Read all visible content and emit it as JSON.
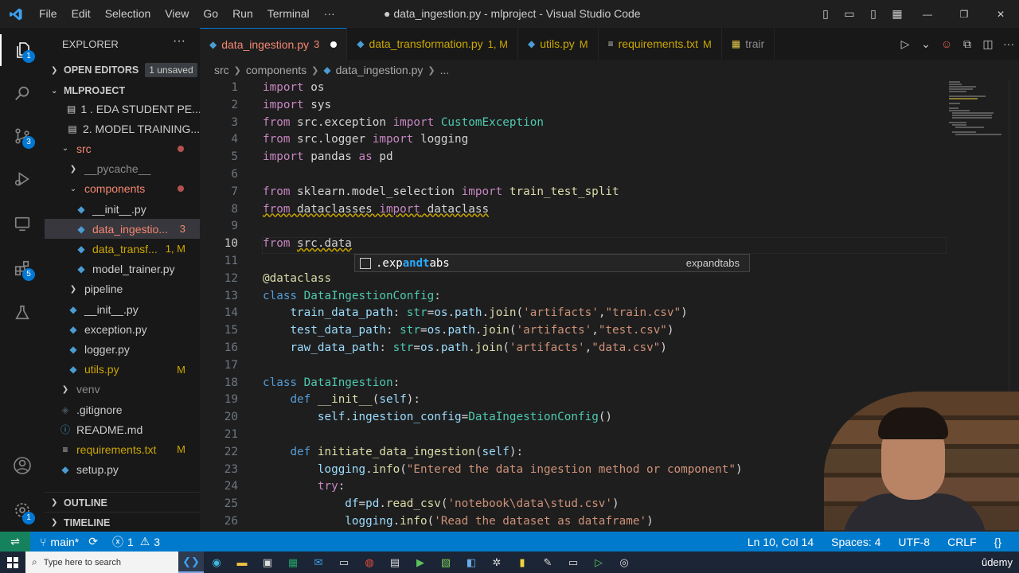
{
  "titlebar": {
    "menu": [
      "File",
      "Edit",
      "Selection",
      "View",
      "Go",
      "Run",
      "Terminal",
      "···"
    ],
    "window_title": "● data_ingestion.py - mlproject - Visual Studio Code"
  },
  "activity": {
    "explorer_badge": "1",
    "source_control_badge": "3",
    "extensions_badge": "5"
  },
  "sidebar": {
    "title": "EXPLORER",
    "open_editors": "OPEN EDITORS",
    "unsaved": "1 unsaved",
    "project": "MLPROJECT",
    "items": [
      {
        "label": "1 . EDA STUDENT PE...",
        "kind": "file",
        "indent": 1,
        "status": ""
      },
      {
        "label": "2. MODEL TRAINING...",
        "kind": "notebook",
        "indent": 1,
        "status": ""
      },
      {
        "label": "src",
        "kind": "folder-open",
        "indent": 0,
        "status": "dot"
      },
      {
        "label": "__pycache__",
        "kind": "folder",
        "indent": 1,
        "status": ""
      },
      {
        "label": "components",
        "kind": "folder-open",
        "indent": 1,
        "status": "dot"
      },
      {
        "label": "__init__.py",
        "kind": "py",
        "indent": 2,
        "status": ""
      },
      {
        "label": "data_ingestio...",
        "kind": "py",
        "indent": 2,
        "status": "3"
      },
      {
        "label": "data_transf...",
        "kind": "py",
        "indent": 2,
        "status": "1, M"
      },
      {
        "label": "model_trainer.py",
        "kind": "py",
        "indent": 2,
        "status": ""
      },
      {
        "label": "pipeline",
        "kind": "folder",
        "indent": 1,
        "status": ""
      },
      {
        "label": "__init__.py",
        "kind": "py",
        "indent": 1,
        "status": ""
      },
      {
        "label": "exception.py",
        "kind": "py",
        "indent": 1,
        "status": ""
      },
      {
        "label": "logger.py",
        "kind": "py",
        "indent": 1,
        "status": ""
      },
      {
        "label": "utils.py",
        "kind": "py",
        "indent": 1,
        "status": "M"
      },
      {
        "label": "venv",
        "kind": "folder",
        "indent": 0,
        "status": ""
      },
      {
        "label": ".gitignore",
        "kind": "git",
        "indent": 0,
        "status": ""
      },
      {
        "label": "README.md",
        "kind": "md",
        "indent": 0,
        "status": ""
      },
      {
        "label": "requirements.txt",
        "kind": "txt",
        "indent": 0,
        "status": "M"
      },
      {
        "label": "setup.py",
        "kind": "py",
        "indent": 0,
        "status": ""
      }
    ],
    "outline": "OUTLINE",
    "timeline": "TIMELINE"
  },
  "tabs": [
    {
      "label": "data_ingestion.py",
      "mod": "3",
      "active": true,
      "dirty": true
    },
    {
      "label": "data_transformation.py",
      "mod": "1, M",
      "active": false,
      "dirty": false
    },
    {
      "label": "utils.py",
      "mod": "M",
      "active": false,
      "dirty": false
    },
    {
      "label": "requirements.txt",
      "mod": "M",
      "active": false,
      "dirty": false
    },
    {
      "label": "trair",
      "mod": "",
      "active": false,
      "dirty": false
    }
  ],
  "breadcrumb": [
    "src",
    "components",
    "data_ingestion.py",
    "..."
  ],
  "editor": {
    "current_line": 10,
    "lines": [
      [
        [
          "kw",
          "import"
        ],
        [
          "t",
          " os"
        ]
      ],
      [
        [
          "kw",
          "import"
        ],
        [
          "t",
          " sys"
        ]
      ],
      [
        [
          "kw",
          "from"
        ],
        [
          "t",
          " src.exception "
        ],
        [
          "kw",
          "import"
        ],
        [
          "t",
          " "
        ],
        [
          "cls",
          "CustomException"
        ]
      ],
      [
        [
          "kw",
          "from"
        ],
        [
          "t",
          " src.logger "
        ],
        [
          "kw",
          "import"
        ],
        [
          "t",
          " logging"
        ]
      ],
      [
        [
          "kw",
          "import"
        ],
        [
          "t",
          " pandas "
        ],
        [
          "kw",
          "as"
        ],
        [
          "t",
          " pd"
        ]
      ],
      [],
      [
        [
          "kw",
          "from"
        ],
        [
          "t",
          " sklearn.model_selection "
        ],
        [
          "kw",
          "import"
        ],
        [
          "t",
          " "
        ],
        [
          "fn",
          "train_test_split"
        ]
      ],
      [
        [
          "kwsq",
          "from"
        ],
        [
          "tsq",
          " dataclasses "
        ],
        [
          "kwsq",
          "import"
        ],
        [
          "tsq",
          " dataclass"
        ]
      ],
      [],
      [
        [
          "kw",
          "from"
        ],
        [
          "t",
          " "
        ],
        [
          "tsq",
          "src.data"
        ]
      ],
      [],
      [
        [
          "fn",
          "@dataclass"
        ]
      ],
      [
        [
          "kb",
          "class"
        ],
        [
          "t",
          " "
        ],
        [
          "cls",
          "DataIngestionConfig"
        ],
        [
          "t",
          ":"
        ]
      ],
      [
        [
          "t",
          "    "
        ],
        [
          "vr",
          "train_data_path"
        ],
        [
          "t",
          ": "
        ],
        [
          "cls",
          "str"
        ],
        [
          "t",
          "="
        ],
        [
          "vr",
          "os"
        ],
        [
          "t",
          "."
        ],
        [
          "vr",
          "path"
        ],
        [
          "t",
          "."
        ],
        [
          "fn",
          "join"
        ],
        [
          "t",
          "("
        ],
        [
          "str",
          "'artifacts'"
        ],
        [
          "t",
          ","
        ],
        [
          "str",
          "\"train.csv\""
        ],
        [
          "t",
          ")"
        ]
      ],
      [
        [
          "t",
          "    "
        ],
        [
          "vr",
          "test_data_path"
        ],
        [
          "t",
          ": "
        ],
        [
          "cls",
          "str"
        ],
        [
          "t",
          "="
        ],
        [
          "vr",
          "os"
        ],
        [
          "t",
          "."
        ],
        [
          "vr",
          "path"
        ],
        [
          "t",
          "."
        ],
        [
          "fn",
          "join"
        ],
        [
          "t",
          "("
        ],
        [
          "str",
          "'artifacts'"
        ],
        [
          "t",
          ","
        ],
        [
          "str",
          "\"test.csv\""
        ],
        [
          "t",
          ")"
        ]
      ],
      [
        [
          "t",
          "    "
        ],
        [
          "vr",
          "raw_data_path"
        ],
        [
          "t",
          ": "
        ],
        [
          "cls",
          "str"
        ],
        [
          "t",
          "="
        ],
        [
          "vr",
          "os"
        ],
        [
          "t",
          "."
        ],
        [
          "vr",
          "path"
        ],
        [
          "t",
          "."
        ],
        [
          "fn",
          "join"
        ],
        [
          "t",
          "("
        ],
        [
          "str",
          "'artifacts'"
        ],
        [
          "t",
          ","
        ],
        [
          "str",
          "\"data.csv\""
        ],
        [
          "t",
          ")"
        ]
      ],
      [],
      [
        [
          "kb",
          "class"
        ],
        [
          "t",
          " "
        ],
        [
          "cls",
          "DataIngestion"
        ],
        [
          "t",
          ":"
        ]
      ],
      [
        [
          "t",
          "    "
        ],
        [
          "kb",
          "def"
        ],
        [
          "t",
          " "
        ],
        [
          "fn",
          "__init__"
        ],
        [
          "t",
          "("
        ],
        [
          "vr",
          "self"
        ],
        [
          "t",
          "):"
        ]
      ],
      [
        [
          "t",
          "        "
        ],
        [
          "vr",
          "self"
        ],
        [
          "t",
          "."
        ],
        [
          "vr",
          "ingestion_config"
        ],
        [
          "t",
          "="
        ],
        [
          "cls",
          "DataIngestionConfig"
        ],
        [
          "t",
          "()"
        ]
      ],
      [],
      [
        [
          "t",
          "    "
        ],
        [
          "kb",
          "def"
        ],
        [
          "t",
          " "
        ],
        [
          "fn",
          "initiate_data_ingestion"
        ],
        [
          "t",
          "("
        ],
        [
          "vr",
          "self"
        ],
        [
          "t",
          "):"
        ]
      ],
      [
        [
          "t",
          "        "
        ],
        [
          "vr",
          "logging"
        ],
        [
          "t",
          "."
        ],
        [
          "fn",
          "info"
        ],
        [
          "t",
          "("
        ],
        [
          "str",
          "\"Entered the data ingestion method or component\""
        ],
        [
          "t",
          ")"
        ]
      ],
      [
        [
          "t",
          "        "
        ],
        [
          "kw",
          "try"
        ],
        [
          "t",
          ":"
        ]
      ],
      [
        [
          "t",
          "            "
        ],
        [
          "vr",
          "df"
        ],
        [
          "t",
          "="
        ],
        [
          "vr",
          "pd"
        ],
        [
          "t",
          "."
        ],
        [
          "fn",
          "read_csv"
        ],
        [
          "t",
          "("
        ],
        [
          "str",
          "'notebook\\data\\stud.csv'"
        ],
        [
          "t",
          ")"
        ]
      ],
      [
        [
          "t",
          "            "
        ],
        [
          "vr",
          "logging"
        ],
        [
          "t",
          "."
        ],
        [
          "fn",
          "info"
        ],
        [
          "t",
          "("
        ],
        [
          "str",
          "'Read the dataset as dataframe'"
        ],
        [
          "t",
          ")"
        ]
      ]
    ]
  },
  "suggest": {
    "label_pre": ".exp",
    "label_match1": "and",
    "label_mid": "",
    "label_match2": "t",
    "label_post": "abs",
    "detail": "expandtabs"
  },
  "statusbar": {
    "remote": "⇌",
    "branch": "main*",
    "errors": "1",
    "warnings": "3",
    "position": "Ln 10, Col 14",
    "spaces": "Spaces: 4",
    "encoding": "UTF-8",
    "eol": "CRLF",
    "braces": "{}"
  },
  "taskbar": {
    "search_placeholder": "Type here to search",
    "watermark": "ûdemy"
  },
  "colors": {
    "accent": "#007acc",
    "editor_bg": "#1e1e1e",
    "sidebar_bg": "#181818",
    "remote": "#16825d"
  }
}
